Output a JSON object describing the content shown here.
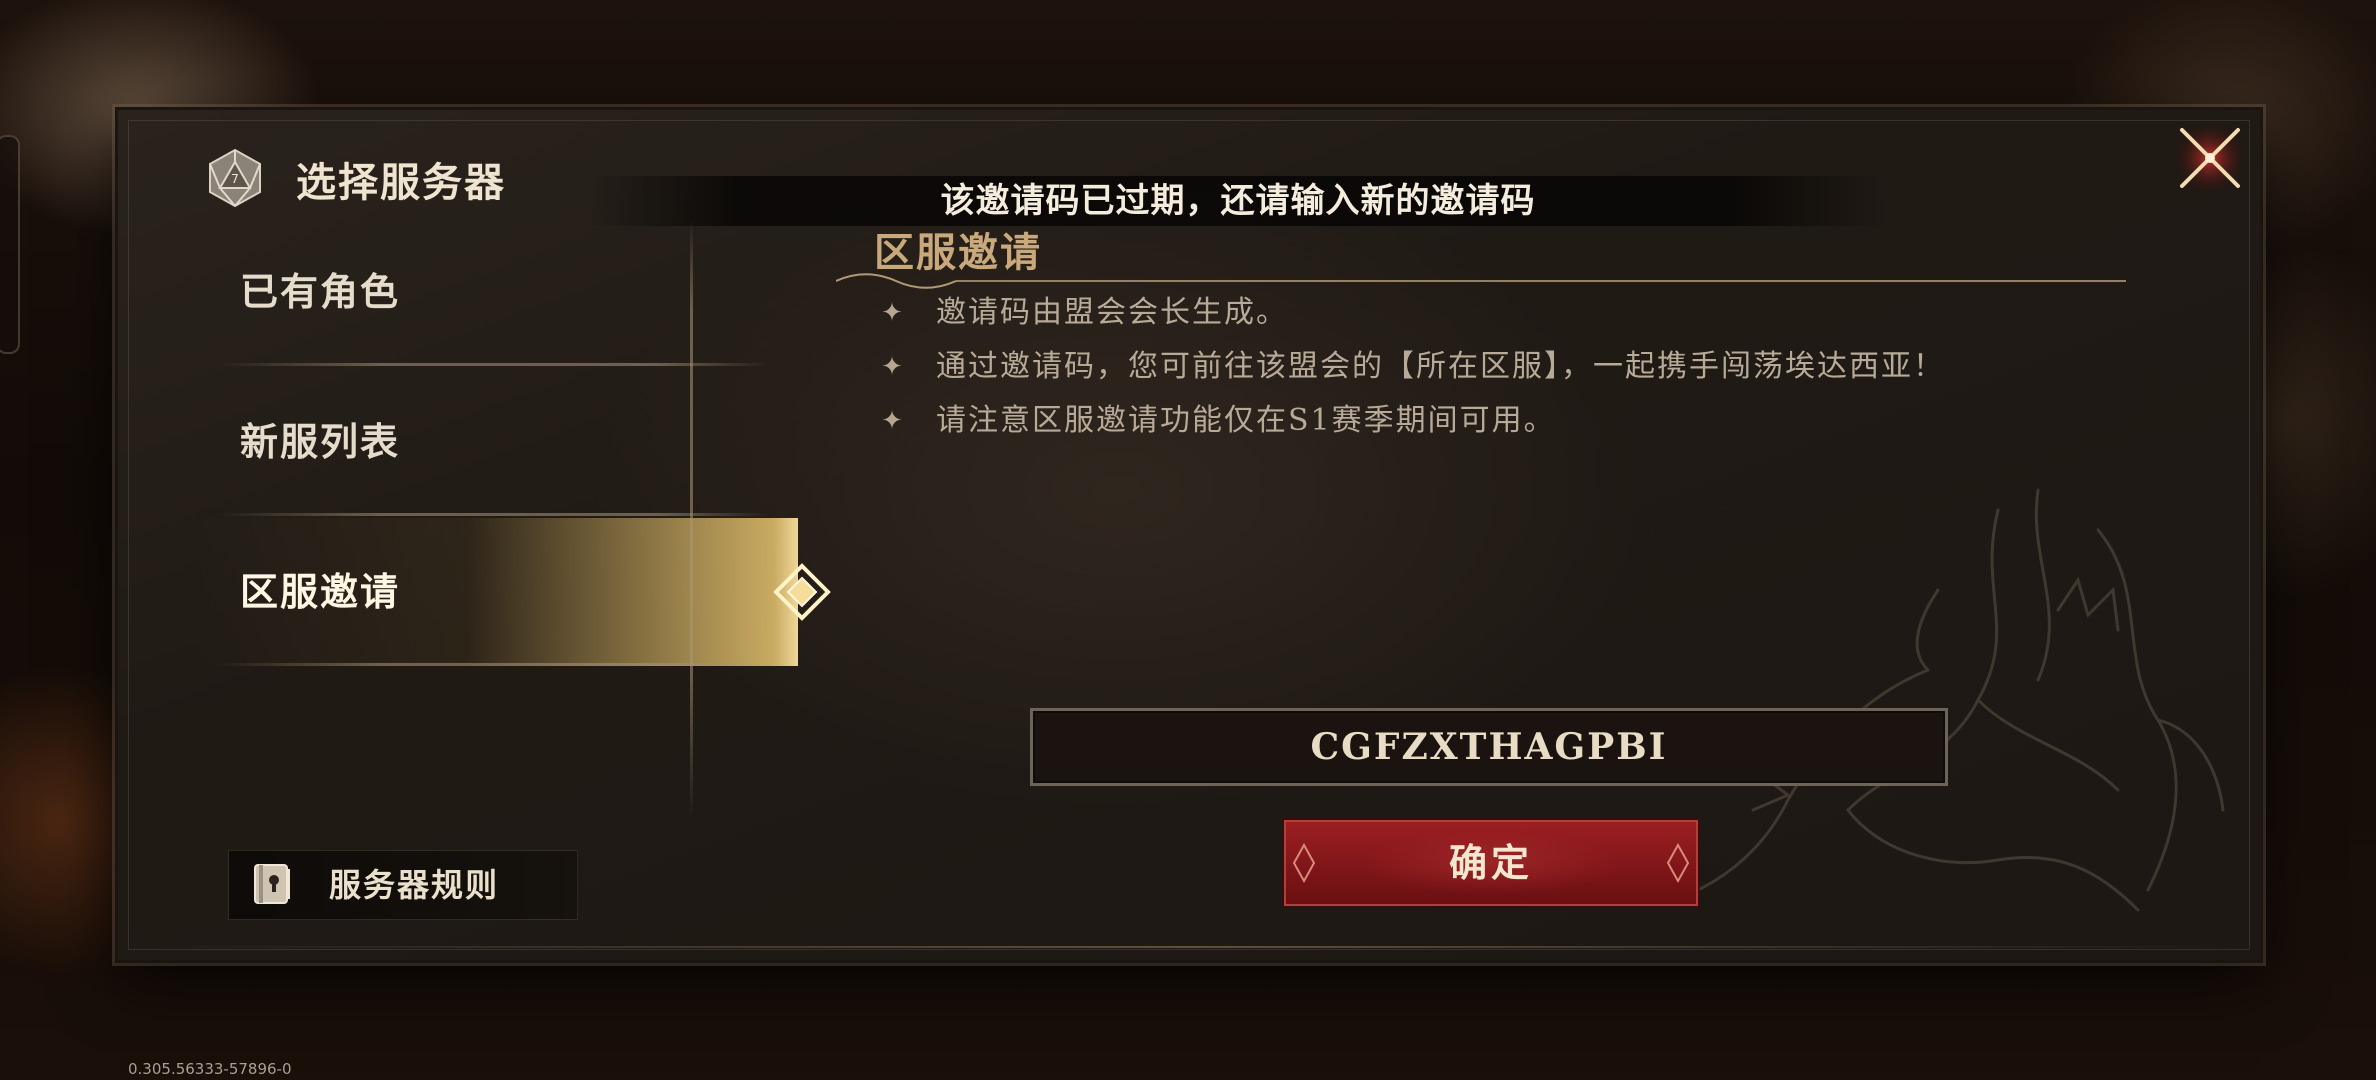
{
  "dialog": {
    "title": "选择服务器",
    "title_icon": "d20-dice-icon",
    "close_icon": "close-x-icon"
  },
  "toast": {
    "message": "该邀请码已过期，还请输入新的邀请码"
  },
  "sidebar": {
    "items": [
      {
        "label": "已有角色",
        "selected": false
      },
      {
        "label": "新服列表",
        "selected": false
      },
      {
        "label": "区服邀请",
        "selected": true
      }
    ],
    "rules_button": {
      "label": "服务器规则",
      "icon": "rulebook-lock-icon"
    }
  },
  "content": {
    "section_title": "区服邀请",
    "bullet_icon": "four-point-star-icon",
    "bullets": [
      "邀请码由盟会会长生成。",
      "通过邀请码，您可前往该盟会的【所在区服】，一起携手闯荡埃达西亚！",
      "请注意区服邀请功能仅在S1赛季期间可用。"
    ],
    "code_input": {
      "value": "CGFZXTHAGPBI"
    },
    "confirm_button": {
      "label": "确定"
    }
  },
  "footer": {
    "version": "0.305.56333-57896-0"
  },
  "colors": {
    "accent_gold": "#c9a97c",
    "confirm_red": "#8a1a1d",
    "panel_bg": "#221c17"
  }
}
